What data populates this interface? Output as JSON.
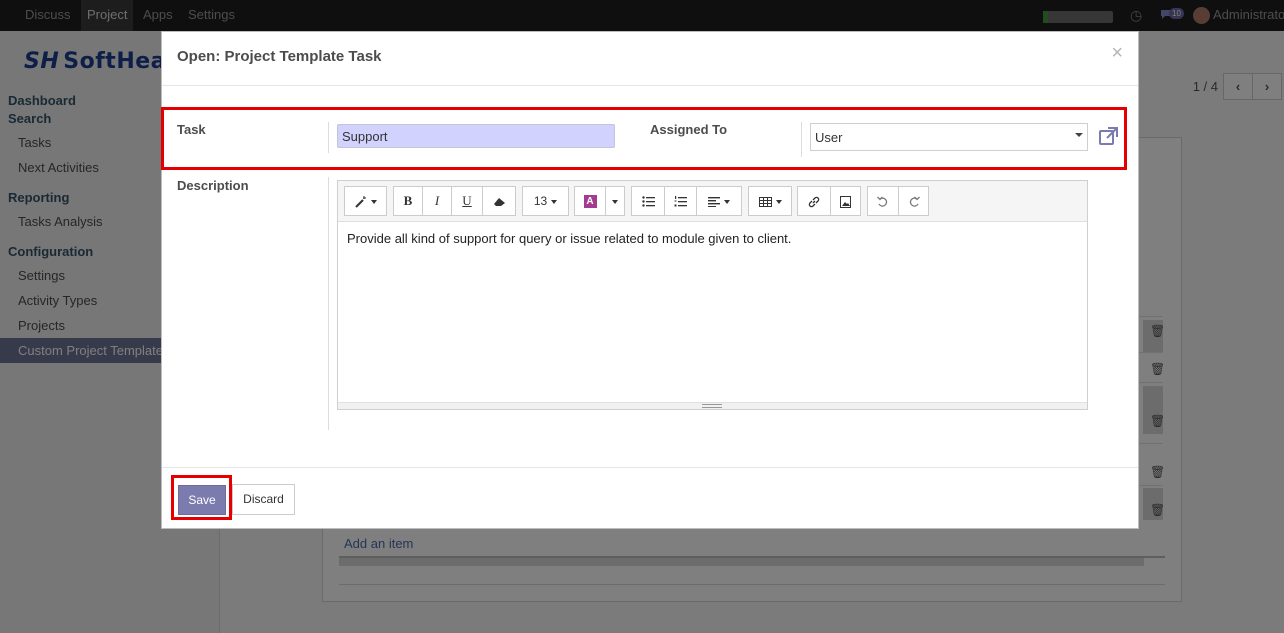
{
  "topnav": {
    "items": [
      "Discuss",
      "Project",
      "Apps",
      "Settings"
    ],
    "active": "Project",
    "message_count": "10",
    "user": "Administrator"
  },
  "brand": {
    "name": "SoftHealer",
    "mark": "SH"
  },
  "sidebar": {
    "dashboard": "Dashboard",
    "search": "Search",
    "tasks": "Tasks",
    "next_activities": "Next Activities",
    "reporting": "Reporting",
    "tasks_analysis": "Tasks Analysis",
    "configuration": "Configuration",
    "settings": "Settings",
    "activity_types": "Activity Types",
    "projects": "Projects",
    "custom_templates": "Custom Project Template"
  },
  "pager": {
    "text": "1 / 4",
    "prev": "‹",
    "next": "›"
  },
  "sheet": {
    "add_item": "Add an item"
  },
  "modal": {
    "title": "Open: Project Template Task",
    "close": "×",
    "task_label": "Task",
    "task_value": "Support",
    "assigned_label": "Assigned To",
    "assigned_value": "User",
    "description_label": "Description",
    "description_text": "Provide all kind of support for query or issue related to module given to client.",
    "font_size": "13",
    "save": "Save",
    "discard": "Discard"
  },
  "colors": {
    "highlight": "#e40000",
    "primary": "#7c7bad",
    "task_input_bg": "#d2d2ff",
    "sidebar_selected": "#6e7496"
  }
}
